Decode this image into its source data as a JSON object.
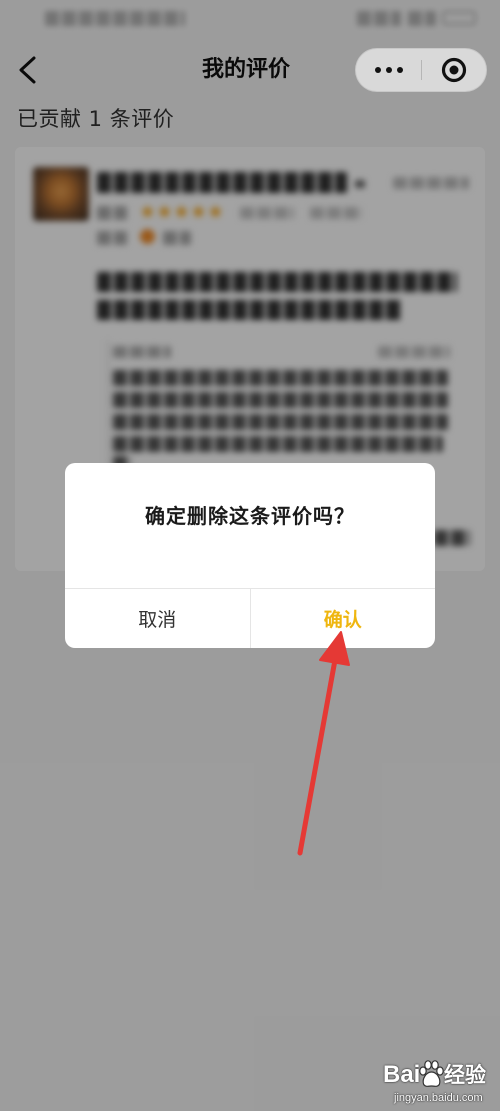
{
  "nav": {
    "title": "我的评价",
    "back_icon": "chevron-left-icon",
    "capsule": {
      "more_icon": "more-dots-icon",
      "close_icon": "target-circle-icon"
    }
  },
  "summary": {
    "contribution_text": "已贡献 1 条评价"
  },
  "review_card": {
    "rating_stars": 5,
    "star_icon": "star-icon",
    "star_color": "#f6a821"
  },
  "dialog": {
    "message": "确定删除这条评价吗？",
    "cancel_label": "取消",
    "confirm_label": "确认",
    "confirm_color": "#efb60f"
  },
  "annotation": {
    "arrow_color": "#e53935"
  },
  "watermark": {
    "brand_left": "Bai",
    "brand_icon": "baidu-paw-icon",
    "brand_right": "经验",
    "site": "jingyan.baidu.com"
  },
  "colors": {
    "mask": "rgba(0,0,0,0.36)"
  }
}
